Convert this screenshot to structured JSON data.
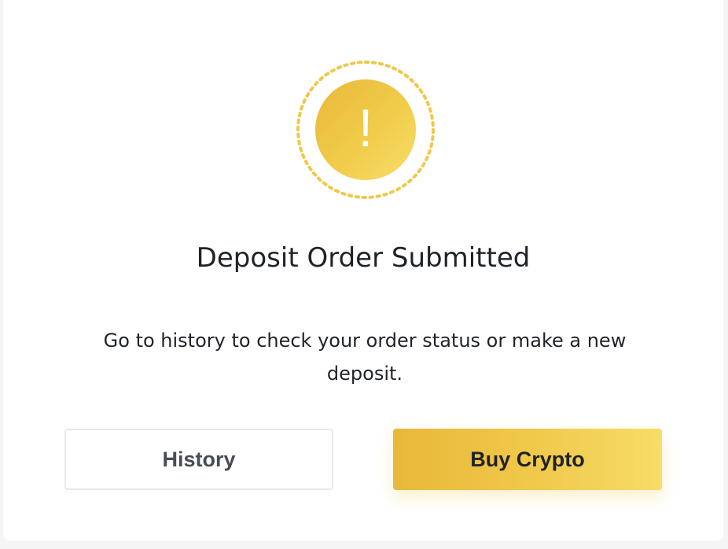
{
  "status": {
    "icon": "exclamation-icon",
    "glyph": "!",
    "colors": {
      "accent_start": "#e8b83a",
      "accent_end": "#f8dd6a",
      "ring": "#f0c84a"
    }
  },
  "dialog": {
    "title": "Deposit Order Submitted",
    "description": "Go to history to check your order status or make a new deposit."
  },
  "actions": {
    "history_label": "History",
    "buy_crypto_label": "Buy Crypto"
  }
}
